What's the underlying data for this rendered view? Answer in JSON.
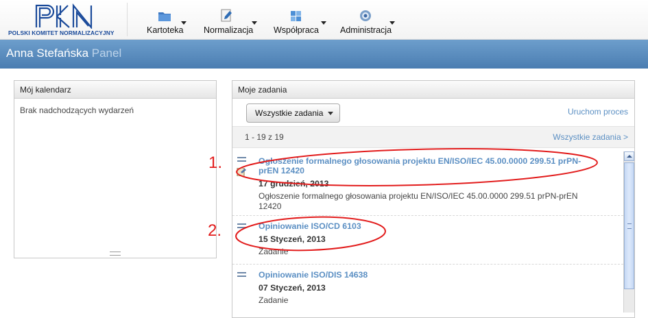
{
  "logo": {
    "text": "POLSKI KOMITET NORMALIZACYJNY",
    "accent": "#1a4a9a"
  },
  "nav": [
    {
      "label": "Kartoteka",
      "icon": "folder-icon"
    },
    {
      "label": "Normalizacja",
      "icon": "document-edit-icon"
    },
    {
      "label": "Współpraca",
      "icon": "puzzle-icon"
    },
    {
      "label": "Administracja",
      "icon": "gear-icon"
    }
  ],
  "header": {
    "name": "Anna Stefańska",
    "suffix": "Panel"
  },
  "calendar": {
    "title": "Mój kalendarz",
    "empty_text": "Brak nadchodzących wydarzeń"
  },
  "tasks": {
    "title": "Moje zadania",
    "filter_label": "Wszystkie zadania",
    "start_process": "Uruchom proces",
    "count": "1 - 19 z 19",
    "all_link": "Wszystkie zadania >",
    "items": [
      {
        "title": "Ogłoszenie formalnego głosowania projektu EN/ISO/IEC 45.00.0000 299.51 prPN-prEN 12420",
        "date": "17 grudzień, 2013",
        "description": "Ogłoszenie formalnego głosowania projektu EN/ISO/IEC 45.00.0000 299.51 prPN-prEN 12420"
      },
      {
        "title": "Opiniowanie ISO/CD 6103",
        "date": "15 Styczeń, 2013",
        "description": "Zadanie"
      },
      {
        "title": "Opiniowanie ISO/DIS 14638",
        "date": "07 Styczeń, 2013",
        "description": "Zadanie"
      }
    ]
  },
  "annotations": [
    "1.",
    "2."
  ],
  "colors": {
    "header": "#5a8ac0",
    "link": "#5b8fc3",
    "annotation": "#e21b1b"
  }
}
